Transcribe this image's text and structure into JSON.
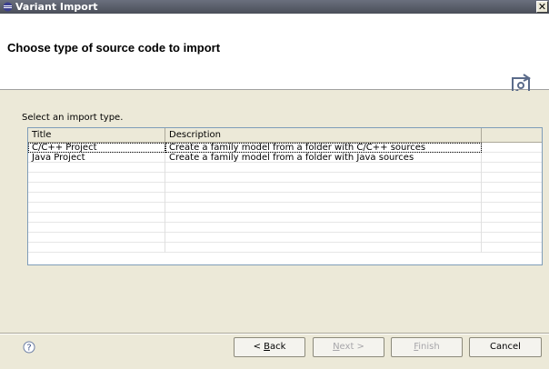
{
  "window": {
    "title": "Variant Import",
    "close_glyph": "✕",
    "icon": "eclipse-icon"
  },
  "header": {
    "page_title": "Choose type of source code to import",
    "wizard_icon": "import-wizard-icon"
  },
  "content": {
    "prompt": "Select an import type.",
    "table": {
      "columns": [
        "Title",
        "Description",
        ""
      ],
      "rows": [
        {
          "title": "C/C++ Project",
          "description": "Create a family model from a folder with C/C++ sources"
        },
        {
          "title": "Java Project",
          "description": "Create a family model from a folder with Java sources"
        },
        {
          "title": "",
          "description": ""
        },
        {
          "title": "",
          "description": ""
        },
        {
          "title": "",
          "description": ""
        },
        {
          "title": "",
          "description": ""
        },
        {
          "title": "",
          "description": ""
        },
        {
          "title": "",
          "description": ""
        },
        {
          "title": "",
          "description": ""
        },
        {
          "title": "",
          "description": ""
        },
        {
          "title": "",
          "description": ""
        }
      ]
    }
  },
  "footer": {
    "help_icon": "help-icon",
    "back": {
      "pre": "< ",
      "mnemonic": "B",
      "post": "ack"
    },
    "next": {
      "pre": "",
      "mnemonic": "N",
      "post": "ext >"
    },
    "finish": {
      "pre": "",
      "mnemonic": "F",
      "post": "inish"
    },
    "cancel": "Cancel"
  },
  "colors": {
    "titlebar": "#4b4f59",
    "dialog_bg": "#ece9d8",
    "table_border": "#7f9db9"
  }
}
